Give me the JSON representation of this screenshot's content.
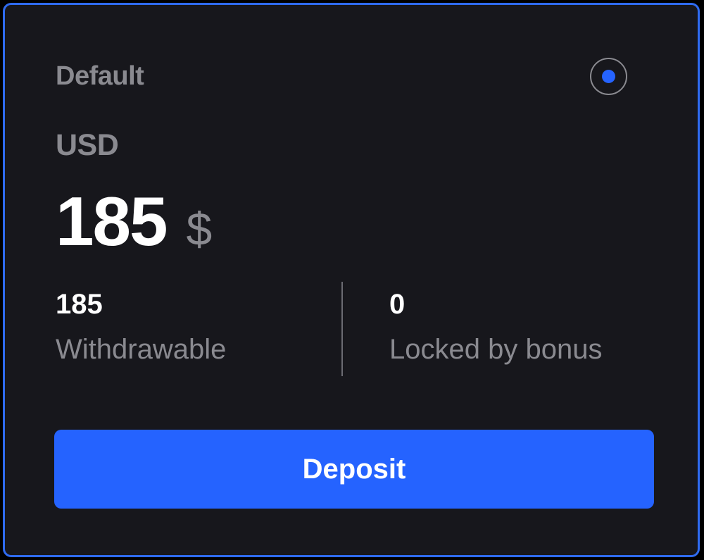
{
  "wallet": {
    "label": "Default",
    "currency_code": "USD",
    "balance": "185",
    "currency_symbol": "$",
    "selected": true,
    "withdrawable": {
      "value": "185",
      "label": "Withdrawable"
    },
    "locked": {
      "value": "0",
      "label": "Locked by bonus"
    },
    "deposit_label": "Deposit"
  },
  "colors": {
    "accent": "#2563ff",
    "card_border": "#2f6bf0",
    "card_background": "#17171c",
    "muted_text": "#8a8a90",
    "primary_text": "#ffffff"
  },
  "icons": {
    "radio": "radio-selected-icon"
  }
}
